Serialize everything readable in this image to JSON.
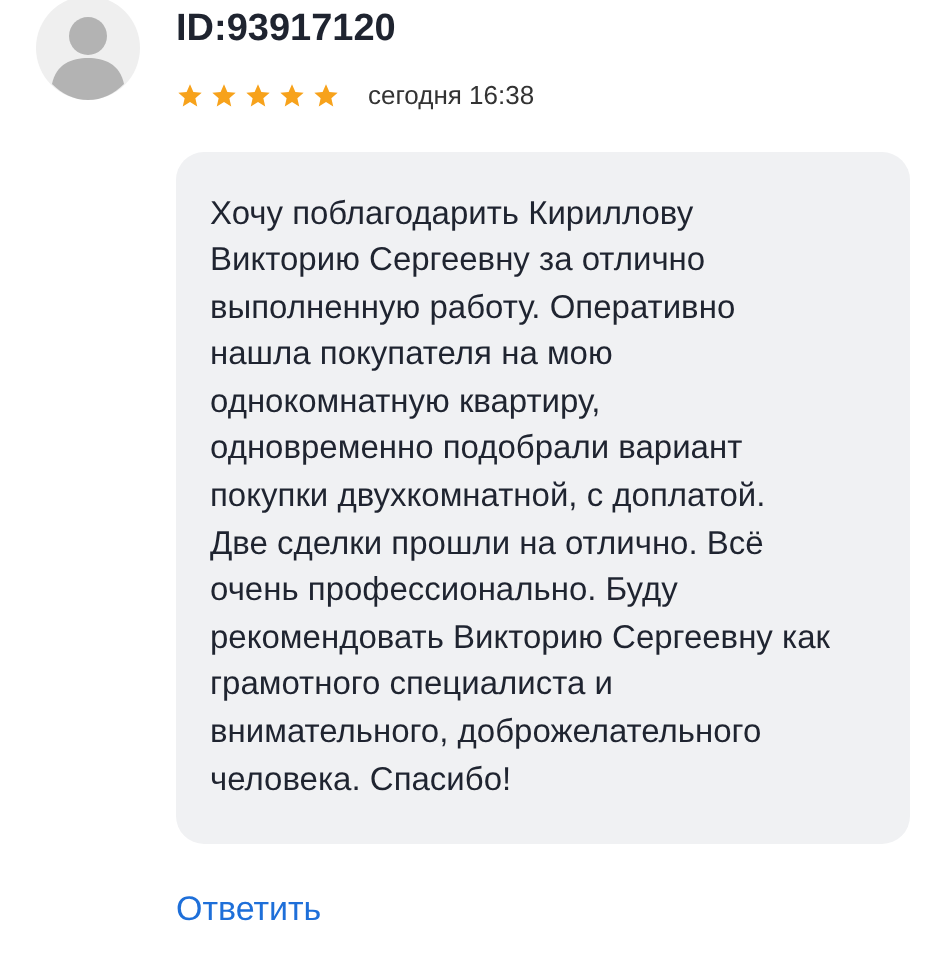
{
  "review": {
    "author": "ID:93917120",
    "stars": 5,
    "time": "сегодня 16:38",
    "text": "Хочу поблагодарить Кириллову\nВикторию Сергеевну за отлично\nвыполненную работу. Оперативно\nнашла покупателя на мою\nоднокомнатную квартиру,\nодновременно подобрали вариант\nпокупки двухкомнатной, с доплатой.\nДве сделки прошли на отлично. Всё\nочень профессионально. Буду\nрекомендовать Викторию Сергеевну как\nграмотного специалиста и\nвнимательного, доброжелательного\nчеловека. Спасибо!",
    "reply_link": "Ответить"
  }
}
